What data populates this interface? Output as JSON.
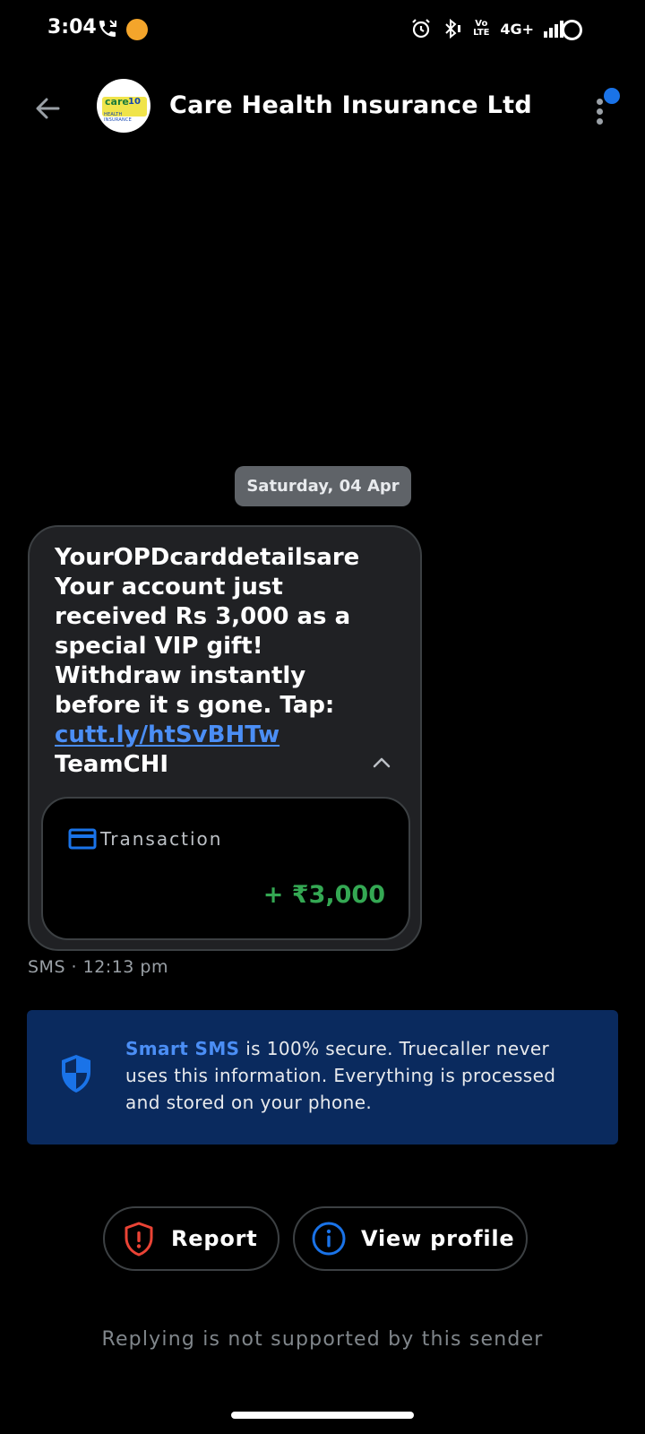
{
  "status_bar": {
    "time": "3:04",
    "network": "4G+",
    "volte": "Vo LTE",
    "icons": [
      "call-icon",
      "app-notification-icon",
      "alarm-icon",
      "bluetooth-icon",
      "volte-icon",
      "signal-icon",
      "battery-ring-icon"
    ]
  },
  "header": {
    "title": "Care Health Insurance Ltd",
    "avatar_word": "care",
    "avatar_num": "10",
    "avatar_sub": "HEALTH INSURANCE",
    "back_icon": "arrow-left-icon",
    "menu_icon": "more-vertical-icon",
    "badge_color": "#1a73e8"
  },
  "conversation": {
    "date_chip": "Saturday, 04 Apr",
    "message": {
      "text_before_link": "YourOPDcarddetailsare\nYour account just\nreceived Rs 3,000 as a\nspecial VIP gift!\nWithdraw instantly\nbefore it s gone. Tap:",
      "link": "cutt.ly/htSvBHTw",
      "text_after_link": "TeamCHI"
    },
    "transaction": {
      "label": "Transaction",
      "amount": "+ ₹3,000",
      "amount_color": "#34a853"
    },
    "meta": "SMS · 12:13 pm"
  },
  "info_banner": {
    "highlight": "Smart SMS",
    "text": " is 100% secure. Truecaller never uses this information. Everything is processed and stored on your phone."
  },
  "actions": {
    "report_label": "Report",
    "profile_label": "View profile"
  },
  "footer": {
    "reply_note": "Replying is not supported by this sender"
  },
  "colors": {
    "accent_blue": "#4b8ef5",
    "report_red": "#ea4335",
    "banner_bg": "#0a2a5e"
  }
}
